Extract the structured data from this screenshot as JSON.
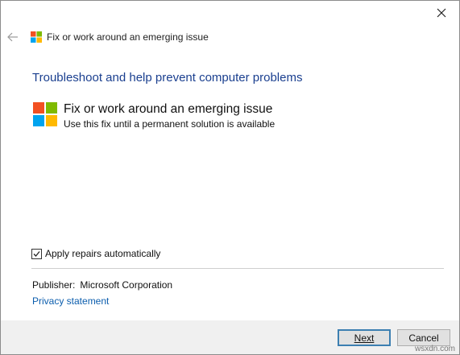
{
  "nav": {
    "title": "Fix or work around an emerging issue",
    "back_icon": "back-arrow-icon",
    "close_icon": "close-icon"
  },
  "main": {
    "heading": "Troubleshoot and help prevent computer problems",
    "issue": {
      "title": "Fix or work around an emerging issue",
      "description": "Use this fix until a permanent solution is available",
      "icon": "windows-logo-icon"
    },
    "apply_repairs": {
      "label": "Apply repairs automatically",
      "checked": true
    },
    "publisher": {
      "label": "Publisher:",
      "value": "Microsoft Corporation"
    },
    "privacy_link": "Privacy statement"
  },
  "footer": {
    "next_label": "Next",
    "cancel_label": "Cancel"
  },
  "watermark": "wsxdn.com",
  "colors": {
    "heading": "#1a3f8f",
    "link": "#0b5dad",
    "logo_red": "#f25022",
    "logo_green": "#7fba00",
    "logo_blue": "#00a4ef",
    "logo_yellow": "#ffb900"
  }
}
